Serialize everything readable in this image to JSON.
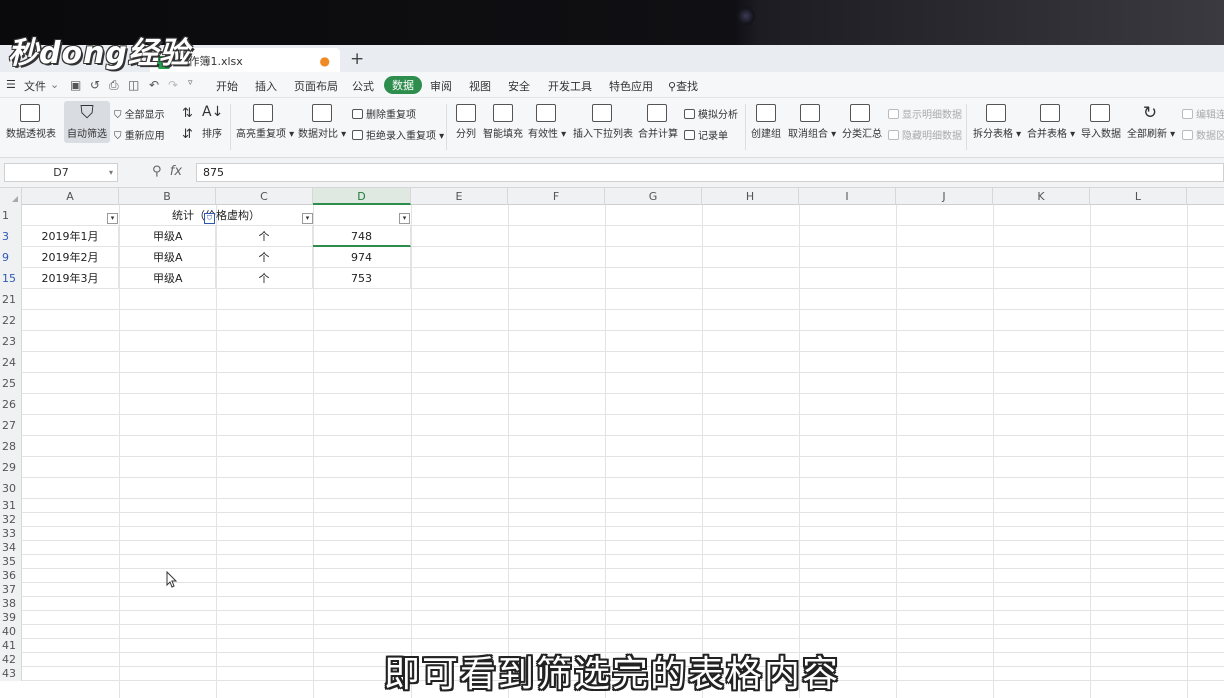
{
  "watermark": "秒dong经验",
  "tabs": {
    "document": "工作簿1.xlsx",
    "new_tab": "+"
  },
  "menu": {
    "file": "文件",
    "items": [
      "开始",
      "插入",
      "页面布局",
      "公式",
      "数据",
      "审阅",
      "视图",
      "安全",
      "开发工具",
      "特色应用"
    ],
    "active": "数据",
    "search": "查找"
  },
  "ribbon": {
    "pivot": "数据透视表",
    "autofilter": "自动筛选",
    "show_all": "全部显示",
    "reapply": "重新应用",
    "sort": "排序",
    "highlight_dup": "高亮重复项",
    "compare": "数据对比",
    "delete_dup": "删除重复项",
    "reject_dup": "拒绝录入重复项",
    "split_col": "分列",
    "smart_fill": "智能填充",
    "validity": "有效性",
    "insert_dropdown": "插入下拉列表",
    "consolidate": "合并计算",
    "whatif": "模拟分析",
    "record": "记录单",
    "create_group": "创建组",
    "ungroup": "取消组合",
    "subtotal": "分类汇总",
    "show_detail": "显示明细数据",
    "hide_detail": "隐藏明细数据",
    "split_table": "拆分表格",
    "merge_table": "合并表格",
    "import": "导入数据",
    "refresh_all": "全部刷新",
    "edit_link": "编辑连",
    "data_area": "数据区"
  },
  "formula_bar": {
    "cell_ref": "D7",
    "value": "875"
  },
  "columns": [
    "A",
    "B",
    "C",
    "D",
    "E",
    "F",
    "G",
    "H",
    "I",
    "J",
    "K",
    "L"
  ],
  "header_row": {
    "row": "1",
    "b": "统计（价格虚构）"
  },
  "rows": [
    {
      "row": "3",
      "a": "2019年1月",
      "b": "甲级A",
      "c": "个",
      "d": "748"
    },
    {
      "row": "9",
      "a": "2019年2月",
      "b": "甲级A",
      "c": "个",
      "d": "974"
    },
    {
      "row": "15",
      "a": "2019年3月",
      "b": "甲级A",
      "c": "个",
      "d": "753"
    }
  ],
  "empty_rows": [
    "21",
    "22",
    "23",
    "24",
    "25",
    "26",
    "27",
    "28",
    "29",
    "30",
    "31",
    "32",
    "33",
    "34",
    "35",
    "36",
    "37",
    "38",
    "39",
    "40",
    "41",
    "42",
    "43"
  ],
  "subtitle": "即可看到筛选完的表格内容"
}
